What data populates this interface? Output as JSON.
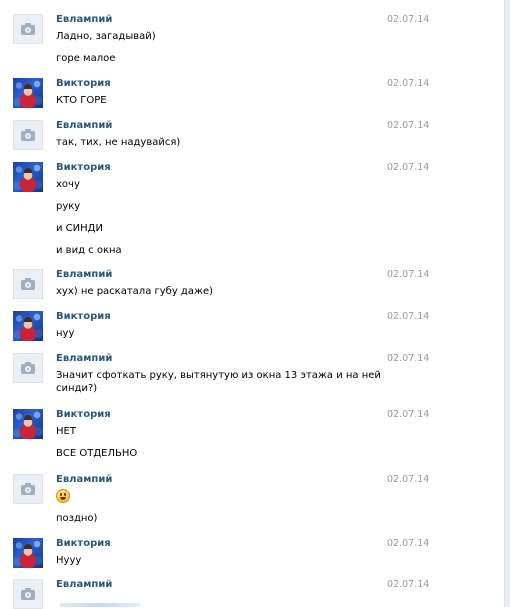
{
  "messages": [
    {
      "author": "Евлампий",
      "date": "02.07.14",
      "avatar": "camera-icon",
      "lines": [
        "Ладно, загадывай)",
        "горе малое"
      ]
    },
    {
      "author": "Виктория",
      "date": "02.07.14",
      "avatar": "user-photo",
      "lines": [
        "КТО ГОРЕ"
      ]
    },
    {
      "author": "Евлампий",
      "date": "02.07.14",
      "avatar": "camera-icon",
      "lines": [
        "так, тих, не надувайся)"
      ]
    },
    {
      "author": "Виктория",
      "date": "02.07.14",
      "avatar": "user-photo",
      "lines": [
        "хочу",
        "руку",
        "и СИНДИ",
        "и вид с окна"
      ]
    },
    {
      "author": "Евлампий",
      "date": "02.07.14",
      "avatar": "camera-icon",
      "lines": [
        "хух) не раскатала губу даже)"
      ]
    },
    {
      "author": "Виктория",
      "date": "02.07.14",
      "avatar": "user-photo",
      "lines": [
        "нуу"
      ]
    },
    {
      "author": "Евлампий",
      "date": "02.07.14",
      "avatar": "camera-icon",
      "lines": [
        "Значит сфоткать руку, вытянутую из окна 13 этажа и на ней",
        "синди?)"
      ]
    },
    {
      "author": "Виктория",
      "date": "02.07.14",
      "avatar": "user-photo",
      "lines": [
        "НЕТ",
        "ВСЕ ОТДЕЛЬНО"
      ]
    },
    {
      "author": "Евлампий",
      "date": "02.07.14",
      "avatar": "camera-icon",
      "lines": [
        "smile-emoji",
        "поздно)"
      ]
    },
    {
      "author": "Виктория",
      "date": "02.07.14",
      "avatar": "user-photo",
      "lines": [
        "Нууу"
      ]
    },
    {
      "author": "Евлампий",
      "date": "02.07.14",
      "avatar": "camera-icon",
      "lines": []
    }
  ],
  "colors": {
    "author": "#2b587a",
    "date": "#999999",
    "text": "#000000"
  }
}
